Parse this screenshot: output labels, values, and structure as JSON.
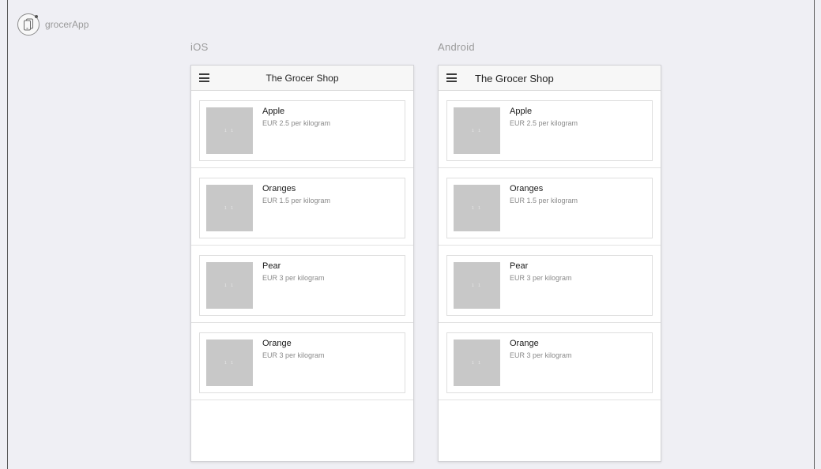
{
  "app": {
    "name": "grocerApp",
    "logo_icon": "phones-icon"
  },
  "ios": {
    "label": "iOS",
    "nav_title": "The Grocer Shop",
    "menu_icon": "hamburger-menu-icon"
  },
  "android": {
    "label": "Android",
    "nav_title": "The Grocer Shop",
    "menu_icon": "hamburger-menu-icon"
  },
  "products": [
    {
      "name": "Apple",
      "price": "EUR 2.5 per kilogram"
    },
    {
      "name": "Oranges",
      "price": "EUR 1.5 per kilogram"
    },
    {
      "name": "Pear",
      "price": "EUR 3 per kilogram"
    },
    {
      "name": "Orange",
      "price": "EUR 3 per kilogram"
    }
  ],
  "thumbnail_placeholder": "1 1",
  "colors": {
    "background": "#efeff4",
    "thumbnail": "#c8c8c8",
    "navbar": "#f7f7f7"
  }
}
